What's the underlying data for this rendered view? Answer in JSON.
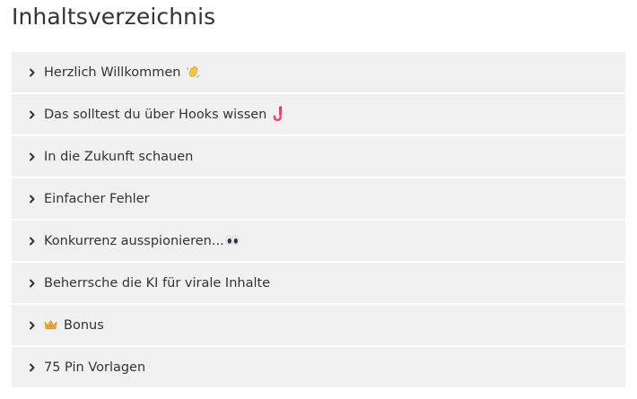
{
  "title": "Inhaltsverzeichnis",
  "items": [
    {
      "label": "Herzlich Willkommen",
      "icon": "waving-hand-icon"
    },
    {
      "label": "Das solltest du über Hooks wissen",
      "icon": "phishing-hook-icon"
    },
    {
      "label": "In die Zukunft schauen"
    },
    {
      "label": "Einfacher Fehler"
    },
    {
      "label": "Konkurrenz ausspionieren...",
      "icon": "eyes-icon"
    },
    {
      "label": "Beherrsche die KI für virale Inhalte"
    },
    {
      "label": "Bonus",
      "icon": "crown-icon"
    },
    {
      "label": "75 Pin Vorlagen"
    }
  ],
  "colors": {
    "item_background": "#f0f0f0",
    "text": "#333333"
  }
}
